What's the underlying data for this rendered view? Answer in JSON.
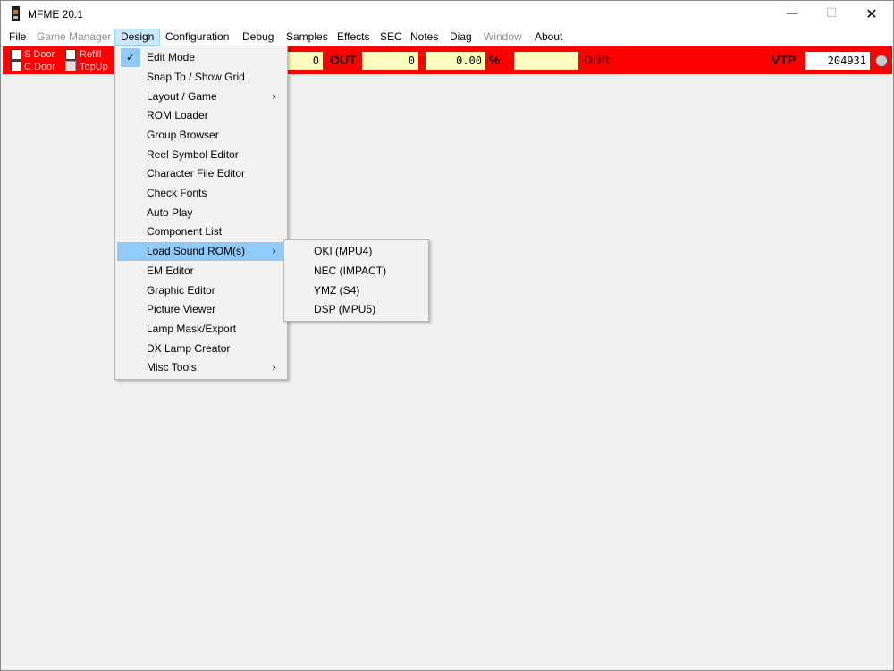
{
  "window": {
    "title": "MFME 20.1",
    "minimize_glyph": "—",
    "maximize_glyph": "☐",
    "close_glyph": "✕"
  },
  "menubar": {
    "items": [
      {
        "label": "File"
      },
      {
        "label": "Game Manager"
      },
      {
        "label": "Design"
      },
      {
        "label": "Configuration"
      },
      {
        "label": "Debug"
      },
      {
        "label": "Samples"
      },
      {
        "label": "Effects"
      },
      {
        "label": "SEC"
      },
      {
        "label": "Notes"
      },
      {
        "label": "Diag"
      },
      {
        "label": "Window"
      },
      {
        "label": "About"
      }
    ]
  },
  "toolbar": {
    "checkboxes": [
      {
        "label": "S Door"
      },
      {
        "label": "C Door"
      },
      {
        "label": "Refill"
      },
      {
        "label": "TopUp"
      }
    ],
    "in_value": "0",
    "out_label": "OUT",
    "out_value": "0",
    "percent_value": "0.00",
    "percent_label": "%",
    "drift_value": "",
    "drift_label": "Drift",
    "vtp_label": "VTP",
    "vtp_value": "204931"
  },
  "design_menu": {
    "checkmark": "✓",
    "submenu_arrow": "›",
    "items": [
      {
        "label": "Edit Mode"
      },
      {
        "label": "Snap To / Show Grid"
      },
      {
        "label": "Layout / Game"
      },
      {
        "label": "ROM Loader"
      },
      {
        "label": "Group Browser"
      },
      {
        "label": "Reel Symbol Editor"
      },
      {
        "label": "Character File Editor"
      },
      {
        "label": "Check Fonts"
      },
      {
        "label": "Auto Play"
      },
      {
        "label": "Component List"
      },
      {
        "label": "Load Sound ROM(s)"
      },
      {
        "label": "EM Editor"
      },
      {
        "label": "Graphic Editor"
      },
      {
        "label": "Picture Viewer"
      },
      {
        "label": "Lamp Mask/Export"
      },
      {
        "label": "DX Lamp Creator"
      },
      {
        "label": "Misc Tools"
      }
    ]
  },
  "sound_rom_submenu": {
    "items": [
      {
        "label": "OKI (MPU4)"
      },
      {
        "label": "NEC (IMPACT)"
      },
      {
        "label": "YMZ (S4)"
      },
      {
        "label": "DSP (MPU5)"
      }
    ]
  },
  "colors": {
    "toolbar_bg": "#ff0000",
    "field_bg": "#ffffc0",
    "menu_highlight": "#91c9f7",
    "menubar_active": "#cce8ff"
  }
}
